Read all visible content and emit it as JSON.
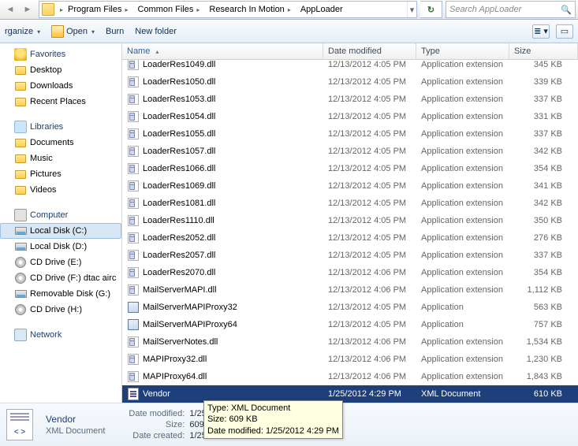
{
  "breadcrumb": {
    "items": [
      "Program Files",
      "Common Files",
      "Research In Motion",
      "AppLoader"
    ]
  },
  "search": {
    "placeholder": "Search AppLoader"
  },
  "toolbar": {
    "organize": "rganize",
    "open": "Open",
    "burn": "Burn",
    "newfolder": "New folder"
  },
  "nav": {
    "favorites": {
      "label": "Favorites",
      "items": [
        {
          "label": "Desktop",
          "icon": "desktop"
        },
        {
          "label": "Downloads",
          "icon": "folder"
        },
        {
          "label": "Recent Places",
          "icon": "folder"
        }
      ]
    },
    "libraries": {
      "label": "Libraries",
      "items": [
        {
          "label": "Documents",
          "icon": "folder"
        },
        {
          "label": "Music",
          "icon": "music"
        },
        {
          "label": "Pictures",
          "icon": "pictures"
        },
        {
          "label": "Videos",
          "icon": "videos"
        }
      ]
    },
    "computer": {
      "label": "Computer",
      "items": [
        {
          "label": "Local Disk (C:)",
          "icon": "drive",
          "selected": true
        },
        {
          "label": "Local Disk (D:)",
          "icon": "drive"
        },
        {
          "label": "CD Drive (E:)",
          "icon": "cd"
        },
        {
          "label": "CD Drive (F:) dtac airc",
          "icon": "cd"
        },
        {
          "label": "Removable Disk (G:)",
          "icon": "drive"
        },
        {
          "label": "CD Drive (H:)",
          "icon": "cd"
        }
      ]
    },
    "network": {
      "label": "Network"
    }
  },
  "columns": {
    "name": "Name",
    "date": "Date modified",
    "type": "Type",
    "size": "Size"
  },
  "files": [
    {
      "name": "LoaderRes1049.dll",
      "date": "12/13/2012 4:05 PM",
      "type": "Application extension",
      "size": "345 KB",
      "icon": "dll"
    },
    {
      "name": "LoaderRes1050.dll",
      "date": "12/13/2012 4:05 PM",
      "type": "Application extension",
      "size": "339 KB",
      "icon": "dll"
    },
    {
      "name": "LoaderRes1053.dll",
      "date": "12/13/2012 4:05 PM",
      "type": "Application extension",
      "size": "337 KB",
      "icon": "dll"
    },
    {
      "name": "LoaderRes1054.dll",
      "date": "12/13/2012 4:05 PM",
      "type": "Application extension",
      "size": "331 KB",
      "icon": "dll"
    },
    {
      "name": "LoaderRes1055.dll",
      "date": "12/13/2012 4:05 PM",
      "type": "Application extension",
      "size": "337 KB",
      "icon": "dll"
    },
    {
      "name": "LoaderRes1057.dll",
      "date": "12/13/2012 4:05 PM",
      "type": "Application extension",
      "size": "342 KB",
      "icon": "dll"
    },
    {
      "name": "LoaderRes1066.dll",
      "date": "12/13/2012 4:05 PM",
      "type": "Application extension",
      "size": "354 KB",
      "icon": "dll"
    },
    {
      "name": "LoaderRes1069.dll",
      "date": "12/13/2012 4:05 PM",
      "type": "Application extension",
      "size": "341 KB",
      "icon": "dll"
    },
    {
      "name": "LoaderRes1081.dll",
      "date": "12/13/2012 4:05 PM",
      "type": "Application extension",
      "size": "342 KB",
      "icon": "dll"
    },
    {
      "name": "LoaderRes1110.dll",
      "date": "12/13/2012 4:05 PM",
      "type": "Application extension",
      "size": "350 KB",
      "icon": "dll"
    },
    {
      "name": "LoaderRes2052.dll",
      "date": "12/13/2012 4:05 PM",
      "type": "Application extension",
      "size": "276 KB",
      "icon": "dll"
    },
    {
      "name": "LoaderRes2057.dll",
      "date": "12/13/2012 4:05 PM",
      "type": "Application extension",
      "size": "337 KB",
      "icon": "dll"
    },
    {
      "name": "LoaderRes2070.dll",
      "date": "12/13/2012 4:06 PM",
      "type": "Application extension",
      "size": "354 KB",
      "icon": "dll"
    },
    {
      "name": "MailServerMAPI.dll",
      "date": "12/13/2012 4:06 PM",
      "type": "Application extension",
      "size": "1,112 KB",
      "icon": "dll"
    },
    {
      "name": "MailServerMAPIProxy32",
      "date": "12/13/2012 4:05 PM",
      "type": "Application",
      "size": "563 KB",
      "icon": "app"
    },
    {
      "name": "MailServerMAPIProxy64",
      "date": "12/13/2012 4:05 PM",
      "type": "Application",
      "size": "757 KB",
      "icon": "app"
    },
    {
      "name": "MailServerNotes.dll",
      "date": "12/13/2012 4:06 PM",
      "type": "Application extension",
      "size": "1,534 KB",
      "icon": "dll"
    },
    {
      "name": "MAPIProxy32.dll",
      "date": "12/13/2012 4:06 PM",
      "type": "Application extension",
      "size": "1,230 KB",
      "icon": "dll"
    },
    {
      "name": "MAPIProxy64.dll",
      "date": "12/13/2012 4:06 PM",
      "type": "Application extension",
      "size": "1,843 KB",
      "icon": "dll"
    },
    {
      "name": "Vendor",
      "date": "1/25/2012 4:29 PM",
      "type": "XML Document",
      "size": "610 KB",
      "icon": "xml",
      "selected": true
    }
  ],
  "details": {
    "name": "Vendor",
    "type": "XML Document",
    "props": [
      {
        "k": "Date modified:",
        "v": "1/25/2012"
      },
      {
        "k": "Size:",
        "v": "609 KB"
      },
      {
        "k": "Date created:",
        "v": "1/25/2012 4:29 PM"
      }
    ]
  },
  "tooltip": {
    "lines": [
      "Type: XML Document",
      "Size: 609 KB",
      "Date modified: 1/25/2012 4:29 PM"
    ]
  }
}
